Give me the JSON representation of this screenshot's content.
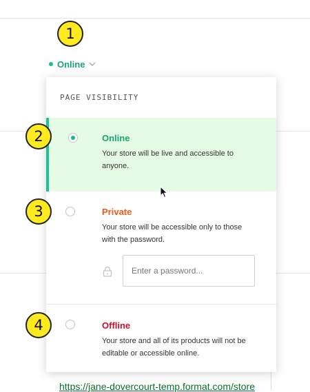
{
  "status_trigger": {
    "label": "Online"
  },
  "annotations": [
    "1",
    "2",
    "3",
    "4"
  ],
  "dropdown": {
    "header": "PAGE VISIBILITY",
    "options": [
      {
        "title": "Online",
        "description": "Your store will be live and accessible to anyone.",
        "selected": true,
        "color": "#17a673"
      },
      {
        "title": "Private",
        "description": "Your store will be accessible only to those with the password.",
        "selected": false,
        "color": "#f05a14"
      },
      {
        "title": "Offline",
        "description": "Your store and all of its products will not be editable or accessible online.",
        "selected": false,
        "color": "#c8102e"
      }
    ],
    "password_placeholder": "Enter a password..."
  },
  "background": {
    "store_url": "https://jane-dovercourt-temp.format.com/store"
  },
  "icons": [
    "chevron-down-icon",
    "lock-icon",
    "mouse-cursor-icon"
  ],
  "colors": {
    "accent": "#1bc490",
    "selected_bg": "#e6fbe4",
    "badge": "#ffe91f"
  }
}
